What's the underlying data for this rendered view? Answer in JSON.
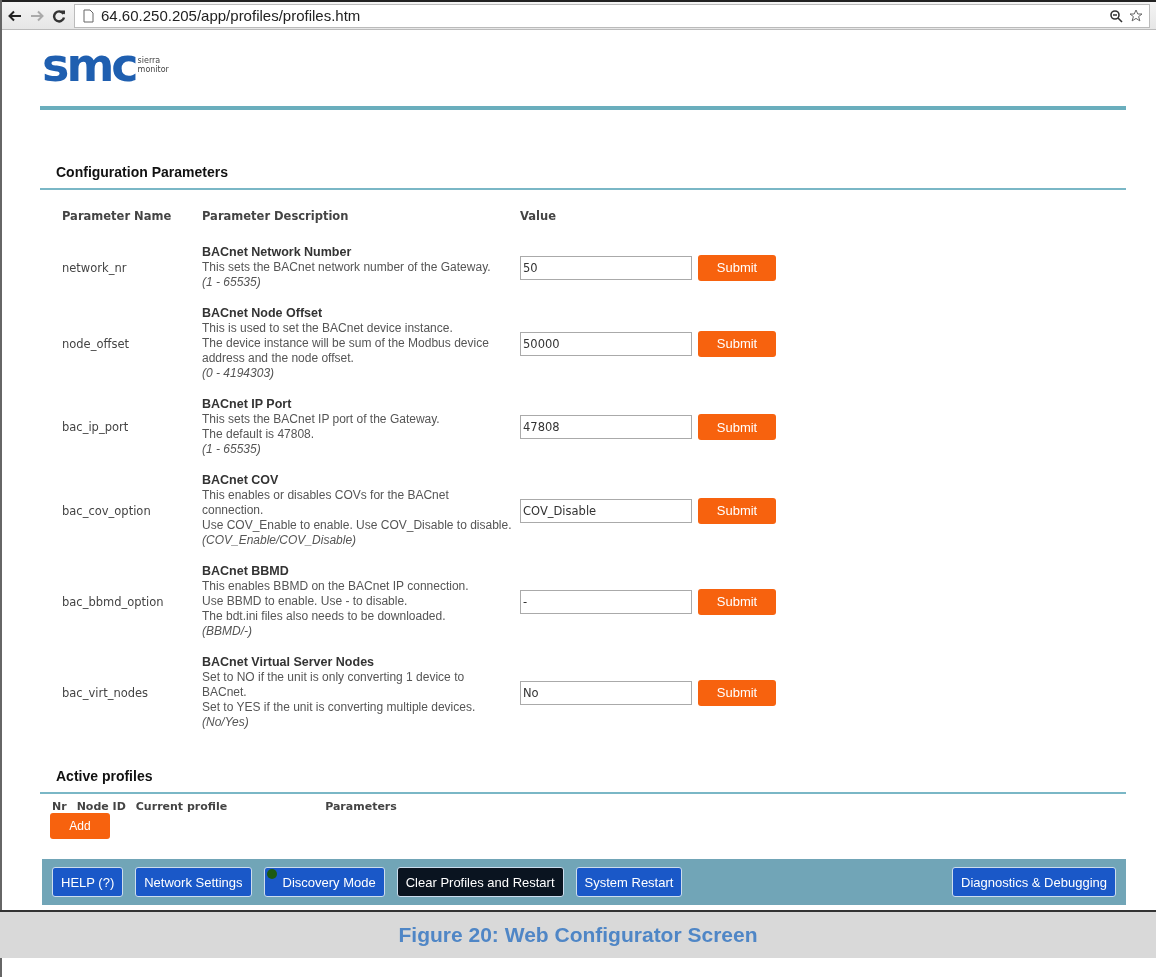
{
  "browser": {
    "url": "64.60.250.205/app/profiles/profiles.htm"
  },
  "logo": {
    "mark": "smc",
    "line_1": "sierra",
    "line_2": "monitor"
  },
  "config": {
    "title": "Configuration Parameters",
    "columns": [
      "Parameter Name",
      "Parameter Description",
      "Value"
    ],
    "rows": [
      {
        "name": "network_nr",
        "title": "BACnet Network Number",
        "lines": [
          "This sets the BACnet network number of the Gateway."
        ],
        "range": "(1 - 65535)",
        "value": "50",
        "button": "Submit"
      },
      {
        "name": "node_offset",
        "title": "BACnet Node Offset",
        "lines": [
          "This is used to set the BACnet device instance.",
          "The device instance will be sum of the Modbus device address and the node offset."
        ],
        "range": "(0 - 4194303)",
        "value": "50000",
        "button": "Submit"
      },
      {
        "name": "bac_ip_port",
        "title": "BACnet IP Port",
        "lines": [
          "This sets the BACnet IP port of the Gateway.",
          "The default is 47808."
        ],
        "range": "(1 - 65535)",
        "value": "47808",
        "button": "Submit"
      },
      {
        "name": "bac_cov_option",
        "title": "BACnet COV",
        "lines": [
          "This enables or disables COVs for the BACnet connection.",
          "Use COV_Enable to enable. Use COV_Disable to disable."
        ],
        "range": "(COV_Enable/COV_Disable)",
        "value": "COV_Disable",
        "button": "Submit"
      },
      {
        "name": "bac_bbmd_option",
        "title": "BACnet BBMD",
        "lines": [
          "This enables BBMD on the BACnet IP connection.",
          "Use BBMD to enable. Use - to disable.",
          "The bdt.ini files also needs to be downloaded."
        ],
        "range": "(BBMD/-)",
        "value": "-",
        "button": "Submit"
      },
      {
        "name": "bac_virt_nodes",
        "title": "BACnet Virtual Server Nodes",
        "lines": [
          "Set to NO if the unit is only converting 1 device to BACnet.",
          "Set to YES if the unit is converting multiple devices."
        ],
        "range": "(No/Yes)",
        "value": "No",
        "button": "Submit"
      }
    ]
  },
  "profiles": {
    "title": "Active profiles",
    "columns": [
      "Nr",
      "Node ID",
      "Current profile",
      "Parameters"
    ],
    "add_button": "Add"
  },
  "footer": {
    "left": [
      {
        "label": "HELP (?)",
        "kind": "blue",
        "indicator": false
      },
      {
        "label": "Network Settings",
        "kind": "blue",
        "indicator": false
      },
      {
        "label": "Discovery Mode",
        "kind": "blue",
        "indicator": true
      },
      {
        "label": "Clear Profiles and Restart",
        "kind": "dark",
        "indicator": false
      },
      {
        "label": "System Restart",
        "kind": "blue",
        "indicator": false
      }
    ],
    "right": [
      {
        "label": "Diagnostics & Debugging",
        "kind": "blue",
        "indicator": false
      }
    ]
  },
  "caption": "Figure 20: Web Configurator Screen"
}
